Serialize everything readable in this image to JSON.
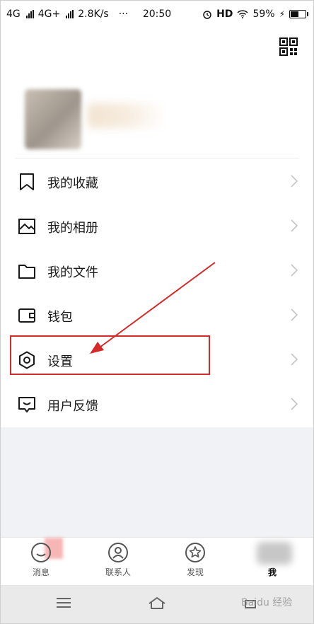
{
  "status_bar": {
    "network1": "4G",
    "network2": "4G+",
    "speed": "2.8K/s",
    "dots": "···",
    "time": "20:50",
    "hd": "HD",
    "battery_pct": "59%",
    "battery_level": 0.59
  },
  "menu": {
    "items": [
      {
        "label": "我的收藏",
        "icon": "bookmark-icon"
      },
      {
        "label": "我的相册",
        "icon": "image-icon"
      },
      {
        "label": "我的文件",
        "icon": "folder-icon"
      },
      {
        "label": "钱包",
        "icon": "wallet-icon"
      },
      {
        "label": "设置",
        "icon": "settings-icon"
      },
      {
        "label": "用户反馈",
        "icon": "feedback-icon"
      }
    ]
  },
  "tabs": [
    {
      "label": "消息",
      "icon": "chat-icon"
    },
    {
      "label": "联系人",
      "icon": "contacts-icon"
    },
    {
      "label": "发现",
      "icon": "discover-icon"
    },
    {
      "label": "我",
      "icon": "profile-icon"
    }
  ],
  "watermark": "Baidu 经验",
  "colors": {
    "highlight": "#d42a2a",
    "background": "#ffffff",
    "grey_area": "#f1f2f5"
  }
}
